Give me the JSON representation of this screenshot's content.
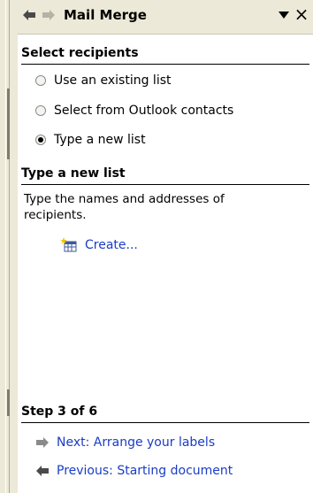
{
  "pane": {
    "title": "Mail Merge",
    "close_glyph": "×"
  },
  "select_recipients": {
    "heading": "Select recipients",
    "options": [
      {
        "label": "Use an existing list",
        "checked": false
      },
      {
        "label": "Select from Outlook contacts",
        "checked": false
      },
      {
        "label": "Type a new list",
        "checked": true
      }
    ]
  },
  "type_new_list": {
    "heading": "Type a new list",
    "description": "Type the names and addresses of recipients.",
    "create_link": "Create..."
  },
  "step": {
    "heading": "Step 3 of 6",
    "next_link": "Next: Arrange your labels",
    "previous_link": "Previous: Starting document"
  },
  "icons": {
    "back": "back-arrow-icon",
    "forward": "forward-arrow-icon",
    "dropdown": "dropdown-triangle-icon",
    "close": "close-icon",
    "create": "new-list-icon",
    "next": "next-arrow-icon",
    "previous": "previous-arrow-icon"
  },
  "colors": {
    "link": "#1a3cc6",
    "titlebar": "#ece9d8"
  }
}
